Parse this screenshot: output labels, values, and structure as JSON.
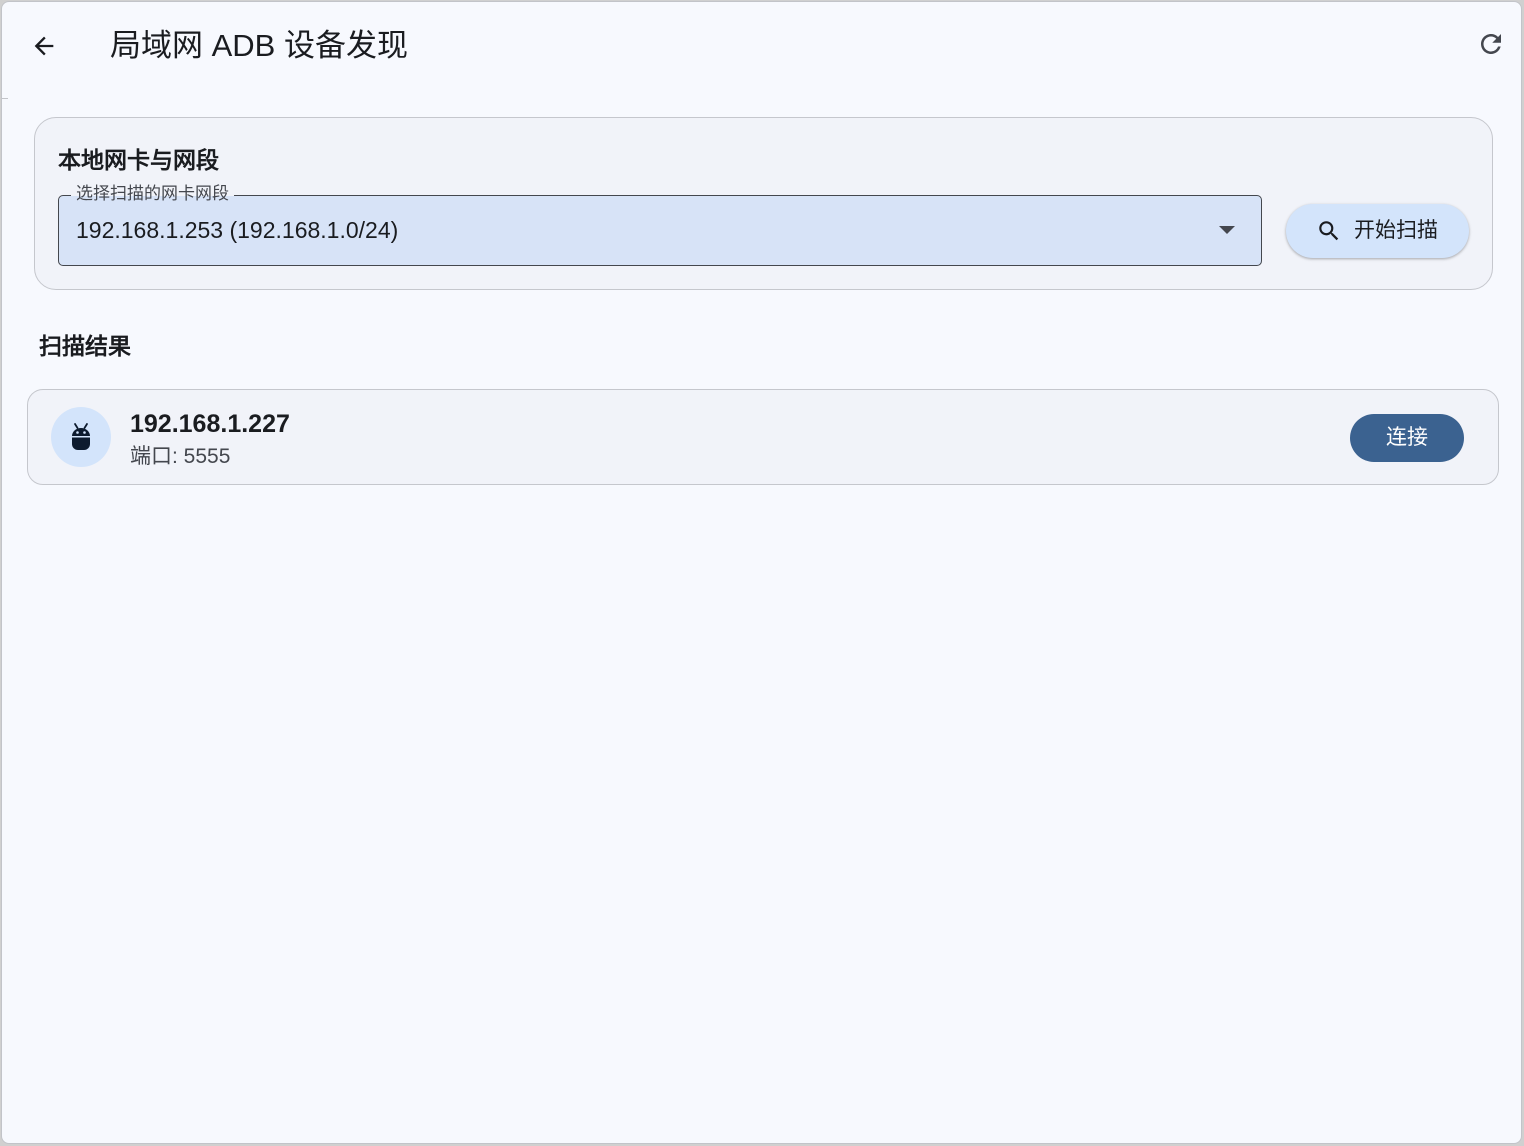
{
  "appbar": {
    "title": "局域网 ADB 设备发现",
    "back_icon": "arrow-back-icon",
    "refresh_icon": "refresh-icon"
  },
  "network_card": {
    "title": "本地网卡与网段",
    "select": {
      "label": "选择扫描的网卡网段",
      "value": "192.168.1.253 (192.168.1.0/24)"
    },
    "scan_button": {
      "label": "开始扫描",
      "icon": "search-icon"
    }
  },
  "results": {
    "title": "扫描结果",
    "devices": [
      {
        "ip": "192.168.1.227",
        "port_text": "端口: 5555",
        "icon": "android-icon",
        "connect_label": "连接"
      }
    ]
  },
  "colors": {
    "background": "#f7f9fe",
    "card": "#f1f3f9",
    "select_fill": "#d7e3f7",
    "tonal_button": "#d3e4fb",
    "primary": "#3b6290",
    "on_surface": "#1a1c20"
  }
}
